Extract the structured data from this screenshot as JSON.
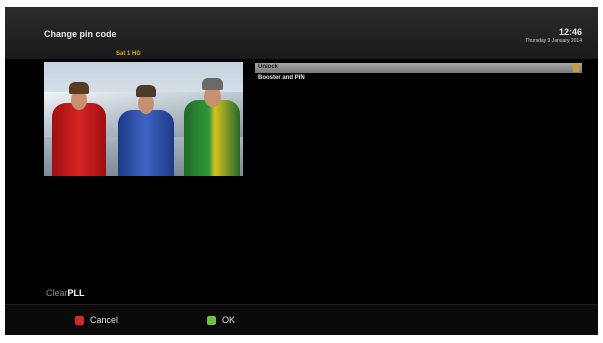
{
  "header": {
    "title": "Change pin code",
    "time": "12:46",
    "date": "Thursday 9 January 2014"
  },
  "preview": {
    "channel_label": "Sat 1 HD"
  },
  "options": [
    {
      "label": "Unlock",
      "selected": true
    },
    {
      "label": "Booster and PIN",
      "selected": false
    }
  ],
  "brand": {
    "prefix": "Clear",
    "suffix": "PLL"
  },
  "footer": {
    "cancel_label": "Cancel",
    "ok_label": "OK"
  },
  "colors": {
    "selection_bar": "#8f8f8f",
    "selection_indicator": "#c8a030",
    "cancel_key": "#d02a2a",
    "ok_key": "#6fc23a",
    "channel_label": "#e0a020"
  }
}
